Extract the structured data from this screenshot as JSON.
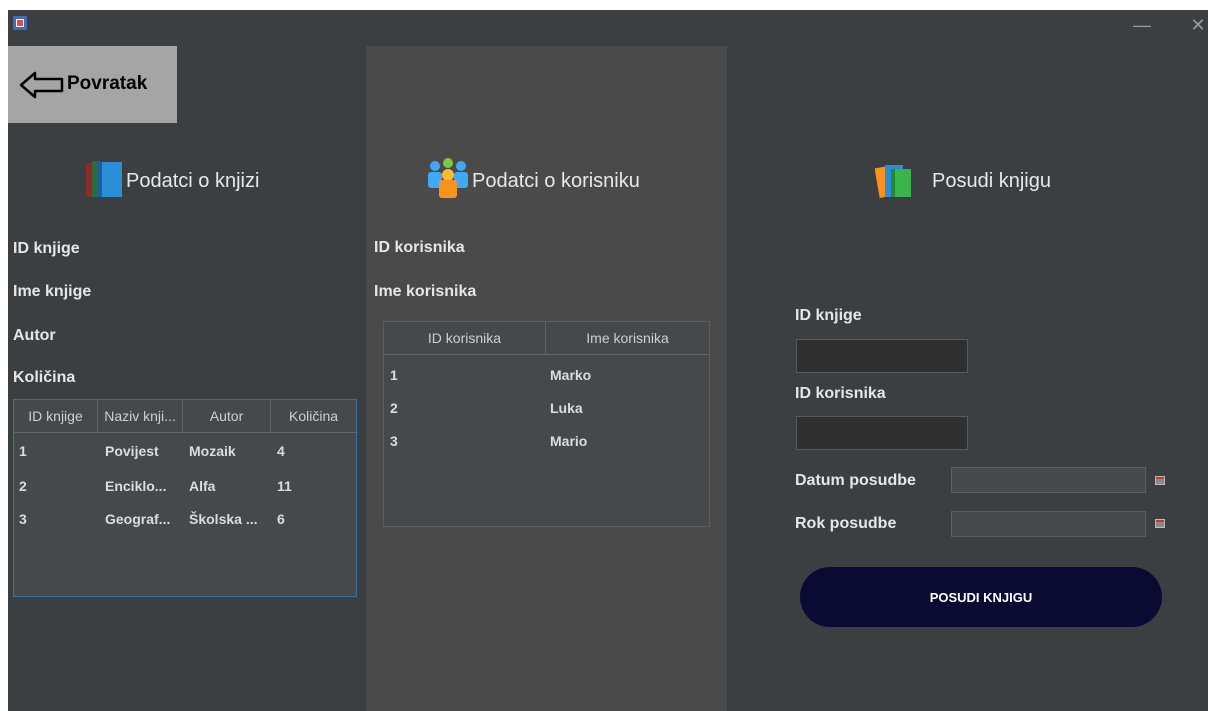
{
  "window": {
    "minimize": "—",
    "close": "✕"
  },
  "back_button": {
    "label": "Povratak",
    "icon": "arrow-left-icon"
  },
  "book_panel": {
    "heading": "Podatci o knjizi",
    "labels": [
      "ID knjige",
      "Ime knjige",
      "Autor",
      "Količina"
    ],
    "table": {
      "columns": [
        "ID knjige",
        "Naziv knji...",
        "Autor",
        "Količina"
      ],
      "rows": [
        [
          "1",
          "Povijest",
          "Mozaik",
          "4"
        ],
        [
          "2",
          "Enciklo...",
          "Alfa",
          "11"
        ],
        [
          "3",
          "Geograf...",
          "Školska ...",
          "6"
        ]
      ]
    }
  },
  "user_panel": {
    "heading": "Podatci o korisniku",
    "labels": [
      "ID korisnika",
      "Ime korisnika"
    ],
    "table": {
      "columns": [
        "ID korisnika",
        "Ime korisnika"
      ],
      "rows": [
        [
          "1",
          "Marko"
        ],
        [
          "2",
          "Luka"
        ],
        [
          "3",
          "Mario"
        ]
      ]
    }
  },
  "loan_panel": {
    "heading": "Posudi knjigu",
    "book_id_label": "ID knjige",
    "user_id_label": "ID korisnika",
    "loan_date_label": "Datum posudbe",
    "due_date_label": "Rok posudbe",
    "submit_label": "POSUDI KNJIGU"
  },
  "colors": {
    "background": "#3c3f41",
    "middle_panel": "#4a4a4a",
    "submit_button": "#0a0a33",
    "back_button": "#a5a5a5"
  }
}
